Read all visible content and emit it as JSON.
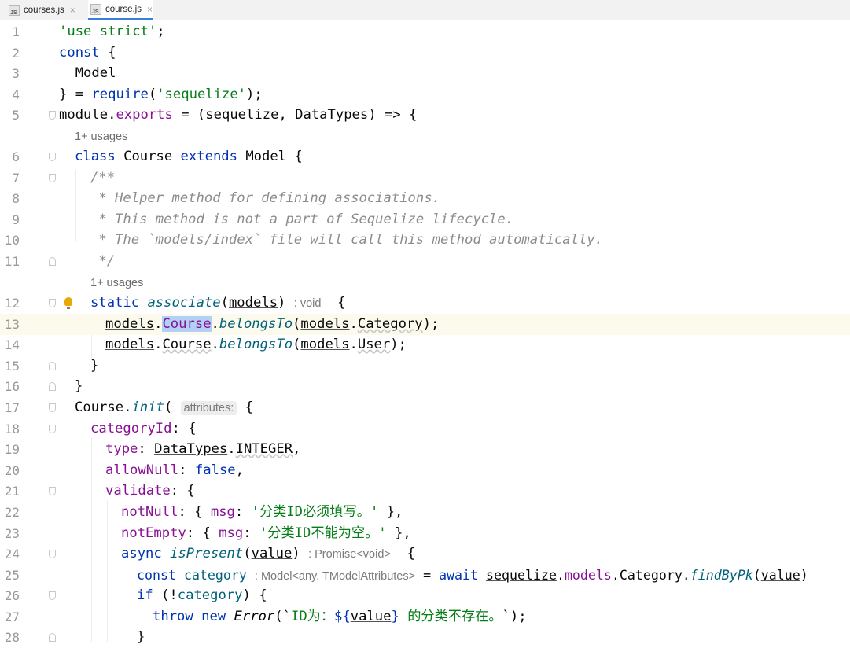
{
  "tabs": [
    {
      "icon": "JS",
      "label": "courses.js",
      "close": "×",
      "active": false
    },
    {
      "icon": "JS",
      "label": "course.js",
      "close": "×",
      "active": true
    }
  ],
  "hints": {
    "usages_class": "1+ usages",
    "usages_method": "1+ usages",
    "return_void": ": void",
    "param_attributes": "attributes:",
    "return_promise": ": Promise<void>",
    "type_category": ": Model<any, TModelAttributes>"
  },
  "lines": {
    "n1": "1",
    "n2": "2",
    "n3": "3",
    "n4": "4",
    "n5": "5",
    "n6": "6",
    "n7": "7",
    "n8": "8",
    "n9": "9",
    "n10": "10",
    "n11": "11",
    "n12": "12",
    "n13": "13",
    "n14": "14",
    "n15": "15",
    "n16": "16",
    "n17": "17",
    "n18": "18",
    "n19": "19",
    "n20": "20",
    "n21": "21",
    "n22": "22",
    "n23": "23",
    "n24": "24",
    "n25": "25",
    "n26": "26",
    "n27": "27",
    "n28": "28"
  },
  "code": {
    "l1_str": "'use strict'",
    "l1_rest": ";",
    "l2_kw": "const",
    "l2_rest": " {",
    "l3": "  Model",
    "l4_a": "} = ",
    "l4_fn": "require",
    "l4_b": "(",
    "l4_str": "'sequelize'",
    "l4_c": ");",
    "l5_a": "module.",
    "l5_prop": "exports",
    "l5_b": " = (",
    "l5_p1": "sequelize",
    "l5_c": ", ",
    "l5_p2": "DataTypes",
    "l5_d": ") => {",
    "l6_kw1": "class",
    "l6_a": " Course ",
    "l6_kw2": "extends",
    "l6_b": " Model {",
    "l7": "/**",
    "l8": " * Helper method for defining associations.",
    "l9": " * This method is not a part of Sequelize lifecycle.",
    "l10": " * The `models/index` file will call this method automatically.",
    "l11": " */",
    "l12_kw": "static",
    "l12_fn": "associate",
    "l12_a": "(",
    "l12_p": "models",
    "l12_b": ")",
    "l12_c": " {",
    "l13_a": "models",
    "l13_b": ".",
    "l13_sel": "Course",
    "l13_c": ".",
    "l13_fn": "belongsTo",
    "l13_d": "(",
    "l13_e": "models",
    "l13_f": ".",
    "l13_g": "Category",
    "l13_h": ");",
    "l14_a": "models",
    "l14_b": ".",
    "l14_c": "Course",
    "l14_d": ".",
    "l14_fn": "belongsTo",
    "l14_e": "(",
    "l14_f": "models",
    "l14_g": ".",
    "l14_h": "User",
    "l14_i": ");",
    "l15": "}",
    "l16": "}",
    "l17_a": "Course.",
    "l17_fn": "init",
    "l17_b": "(",
    "l17_c": " {",
    "l18_prop": "categoryId",
    "l18_rest": ": {",
    "l19_prop": "type",
    "l19_a": ": ",
    "l19_b": "DataTypes",
    "l19_c": ".",
    "l19_d": "INTEGER",
    "l19_e": ",",
    "l20_prop": "allowNull",
    "l20_a": ": ",
    "l20_kw": "false",
    "l20_b": ",",
    "l21_prop": "validate",
    "l21_rest": ": {",
    "l22_prop": "notNull",
    "l22_a": ": { ",
    "l22_prop2": "msg",
    "l22_b": ": ",
    "l22_str": "'分类ID必须填写。'",
    "l22_c": " },",
    "l23_prop": "notEmpty",
    "l23_a": ": { ",
    "l23_prop2": "msg",
    "l23_b": ": ",
    "l23_str": "'分类ID不能为空。'",
    "l23_c": " },",
    "l24_kw": "async",
    "l24_fn": "isPresent",
    "l24_a": "(",
    "l24_p": "value",
    "l24_b": ")",
    "l24_c": " {",
    "l25_kw": "const",
    "l25_var": "category",
    "l25_a": " = ",
    "l25_kw2": "await",
    "l25_b": "sequelize",
    "l25_c": ".",
    "l25_d": "models",
    "l25_e": ".Category.",
    "l25_fn": "findByPk",
    "l25_f": "(",
    "l25_g": "value",
    "l25_h": ")",
    "l26_kw": "if",
    "l26_a": " (!",
    "l26_var": "category",
    "l26_b": ") {",
    "l27_kw1": "throw",
    "l27_kw2": "new",
    "l27_fn": "Error",
    "l27_a": "(`",
    "l27_str1": "ID为：",
    "l27_b": "${",
    "l27_p": "value",
    "l27_c": "}",
    "l27_str2": " 的分类不存在。",
    "l27_d": "`);",
    "l28": "}"
  }
}
